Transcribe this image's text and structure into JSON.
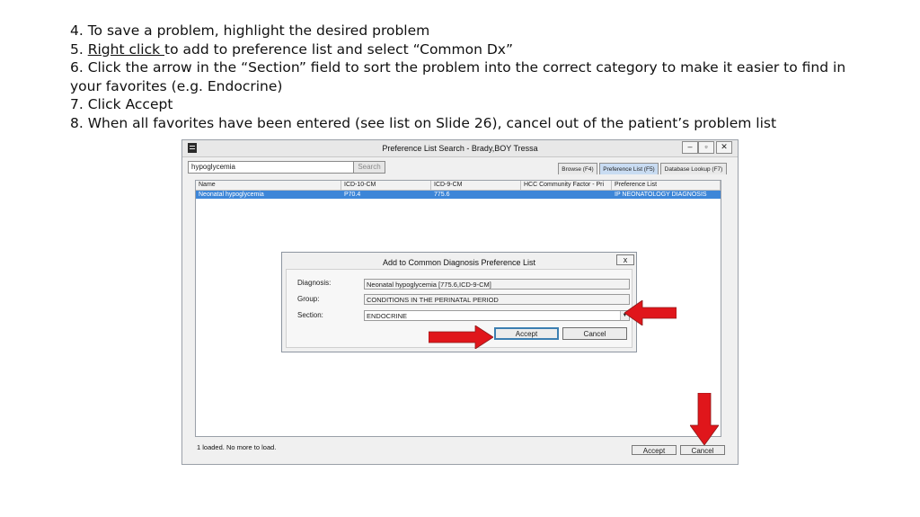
{
  "instructions": {
    "line4": "4. To save a problem, highlight the desired problem",
    "line5_prefix": "5. ",
    "line5_underlined": "Right click ",
    "line5_rest": "to add to preference list and select “Common Dx”",
    "line6a": "6. Click the arrow in the “Section” field to sort the problem into the correct category to make it easier to find in",
    "line6b": "your favorites (e.g. Endocrine)",
    "line7": "7. Click Accept",
    "line8": "8. When all favorites have been entered (see list on Slide 26), cancel out of the patient’s problem list"
  },
  "window": {
    "title": "Preference List Search - Brady,BOY  Tressa",
    "controls": {
      "minimize": "–",
      "restore": "▫",
      "close": "✕"
    },
    "search_value": "hypoglycemia",
    "search_button": "Search",
    "tabs": [
      "Browse (F4)",
      "Preference List (F5)",
      "Database Lookup (F7)"
    ],
    "active_tab_index": 1,
    "columns": [
      "Name",
      "ICD-10-CM",
      "ICD-9-CM",
      "HCC Community Factor - Pri",
      "Preference List"
    ],
    "rows": [
      [
        "Neonatal hypoglycemia",
        "P70.4",
        "775.6",
        "",
        "IP NEONATOLOGY DIAGNOSIS"
      ]
    ],
    "status": "1 loaded. No more to load.",
    "accept_button": "Accept",
    "cancel_button": "Cancel"
  },
  "dialog": {
    "title": "Add to Common Diagnosis Preference List",
    "close": "x",
    "diagnosis_label": "Diagnosis:",
    "diagnosis_value": "Neonatal hypoglycemia [775.6,ICD-9-CM]",
    "group_label": "Group:",
    "group_value": "CONDITIONS IN THE PERINATAL PERIOD",
    "section_label": "Section:",
    "section_value": "ENDOCRINE",
    "accept_button": "Accept",
    "cancel_button": "Cancel"
  },
  "colors": {
    "selection": "#3d86d8",
    "arrow_red": "#e0161b",
    "active_tab": "#c9dcf2"
  }
}
